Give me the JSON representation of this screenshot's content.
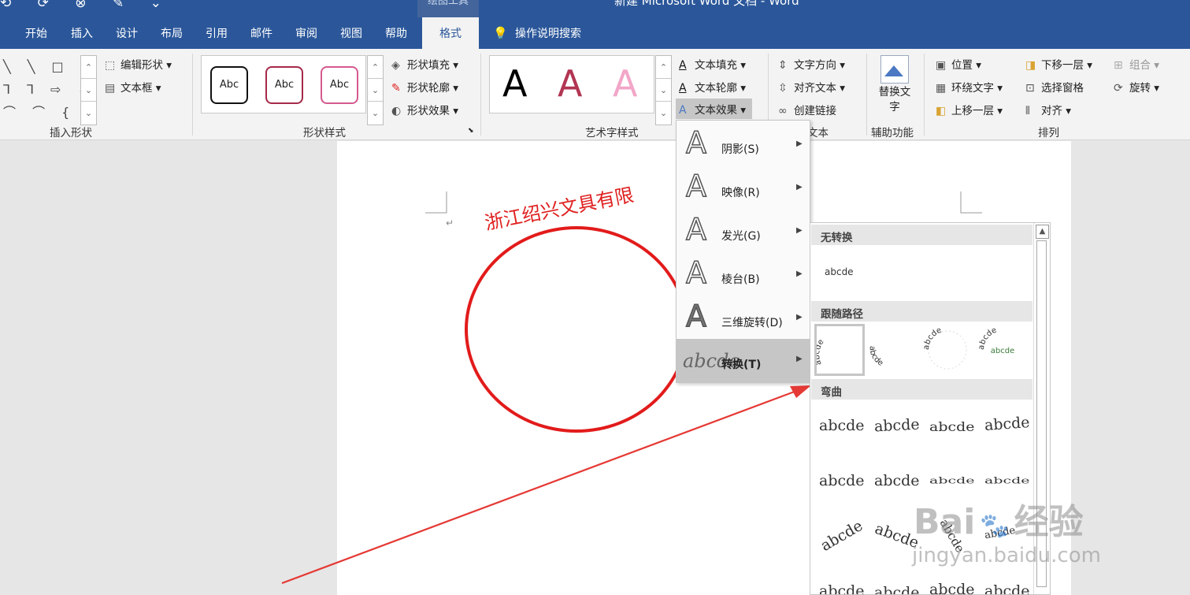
{
  "window": {
    "contextual_group": "绘图工具",
    "title": "新建 Microsoft Word 文档 - Word"
  },
  "tabs": [
    "开始",
    "插入",
    "设计",
    "布局",
    "引用",
    "邮件",
    "审阅",
    "视图",
    "帮助"
  ],
  "active_tab": "格式",
  "tell_me": "操作说明搜索",
  "ribbon": {
    "insert_shapes": {
      "edit_shape": "编辑形状",
      "text_box": "文本框",
      "label": "插入形状"
    },
    "shape_styles": {
      "sample": "Abc",
      "fill": "形状填充",
      "outline": "形状轮廓",
      "effects": "形状效果",
      "label": "形状样式"
    },
    "wordart_styles": {
      "sample": "A",
      "text_fill": "文本填充",
      "text_outline": "文本轮廓",
      "text_effects": "文本效果",
      "label": "艺术字样式"
    },
    "text": {
      "direction": "文字方向",
      "align": "对齐文本",
      "link": "创建链接",
      "label": "文本"
    },
    "accessibility": {
      "alt_text": "替换文字",
      "label": "辅助功能"
    },
    "arrange": {
      "position": "位置",
      "wrap": "环绕文字",
      "forward": "上移一层",
      "backward": "下移一层",
      "pane": "选择窗格",
      "align": "对齐",
      "group": "组合",
      "rotate": "旋转",
      "label": "排列"
    }
  },
  "document": {
    "wordart_text": "浙江绍兴文具有限"
  },
  "effects_menu": [
    {
      "label": "阴影(S)"
    },
    {
      "label": "映像(R)"
    },
    {
      "label": "发光(G)"
    },
    {
      "label": "棱台(B)"
    },
    {
      "label": "三维旋转(D)"
    },
    {
      "label": "转换(T)"
    }
  ],
  "transform_panel": {
    "no_transform": "无转换",
    "sample": "abcde",
    "follow_path": "跟随路径",
    "warp": "弯曲"
  },
  "watermark": {
    "brand": "Bai",
    "brand2": "经验",
    "url": "jingyan.baidu.com"
  },
  "colors": {
    "title_blue": "#2b579a",
    "shape_red": "#e21b1b",
    "arrow_red": "#e53935"
  }
}
